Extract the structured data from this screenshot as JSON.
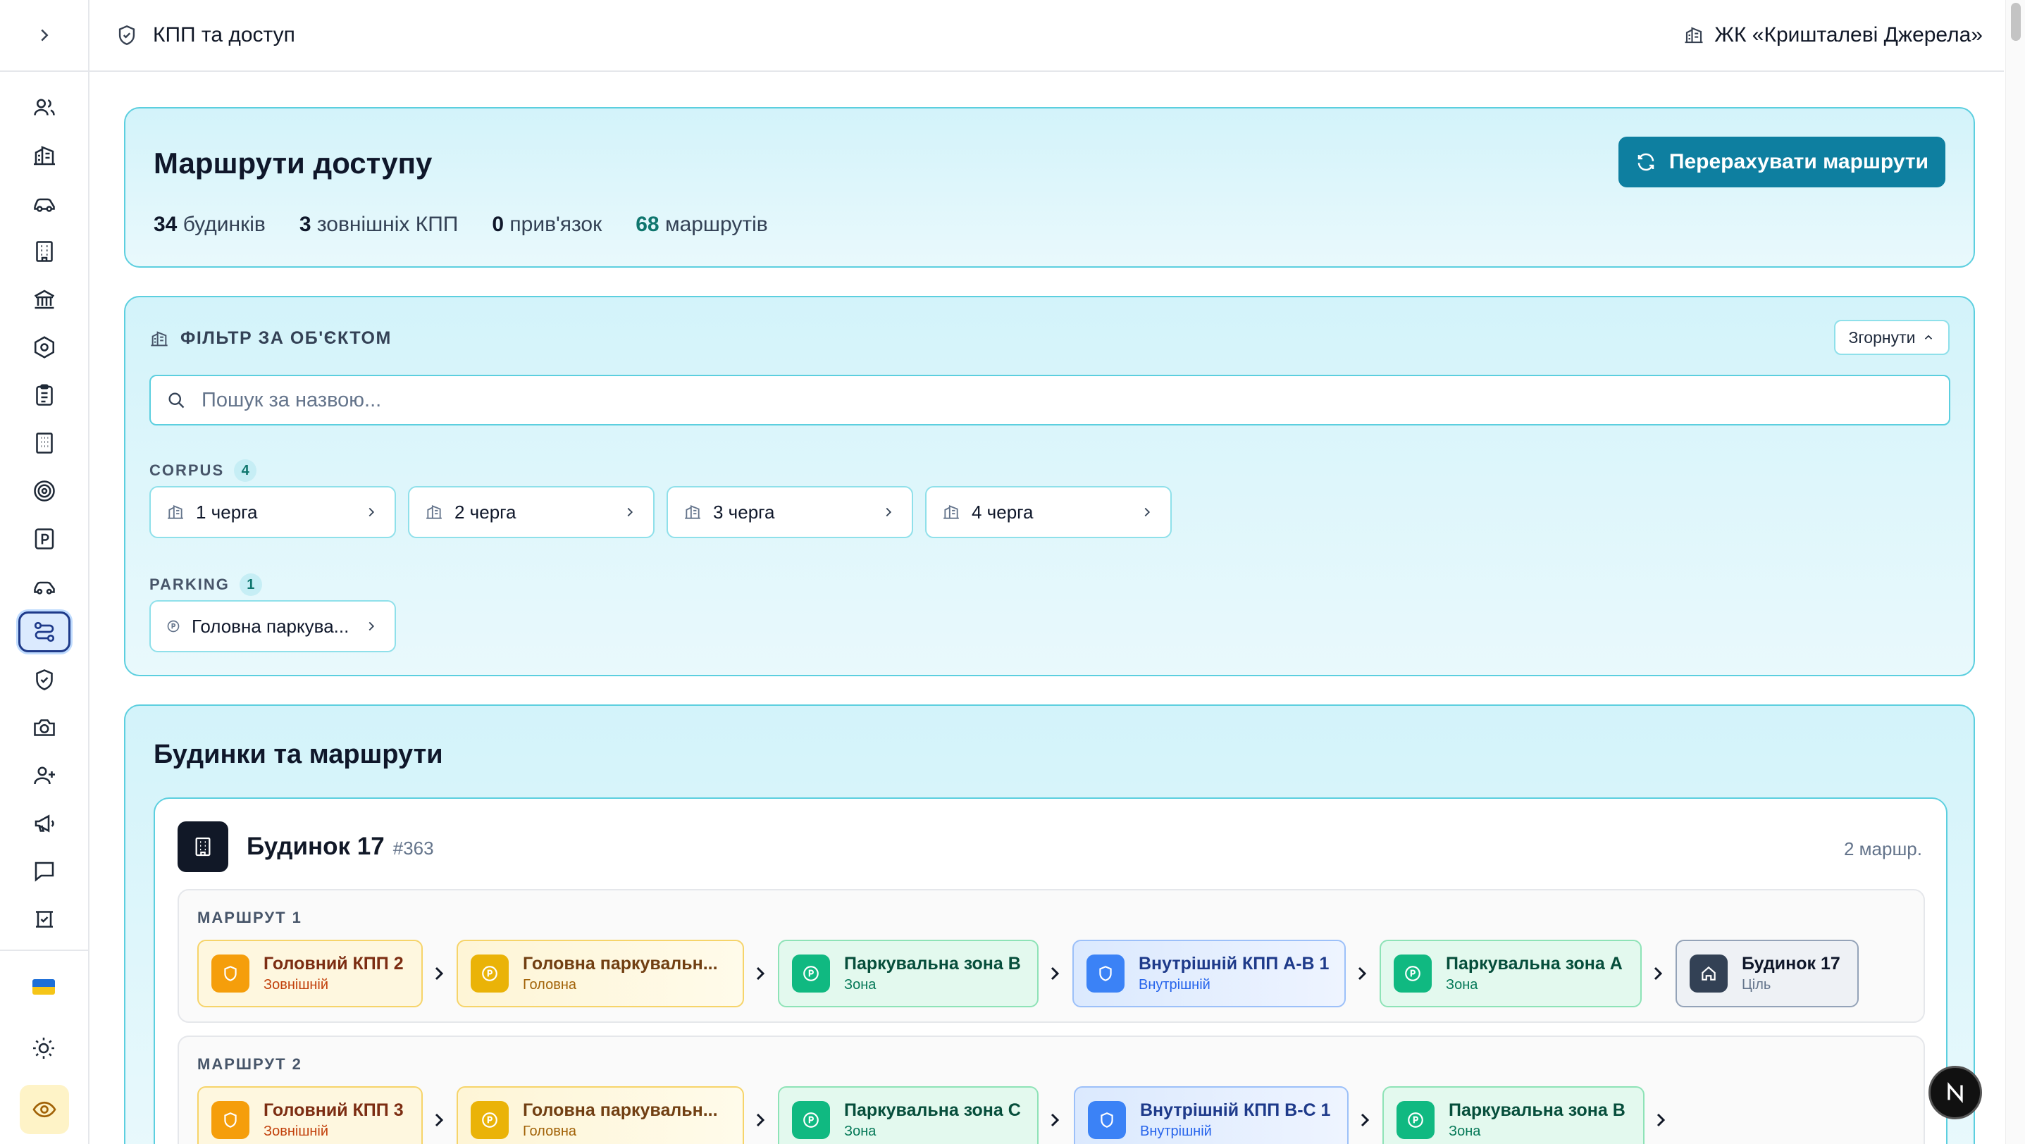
{
  "header": {
    "title": "КПП та доступ",
    "complex": "ЖК «Кришталеві Джерела»"
  },
  "summary": {
    "title": "Маршрути доступу",
    "recalc_label": "Перерахувати маршрути",
    "stats": [
      {
        "value": "34",
        "label": "будинків"
      },
      {
        "value": "3",
        "label": "зовнішніх КПП"
      },
      {
        "value": "0",
        "label": "прив'язок"
      },
      {
        "value": "68",
        "label": "маршрутів"
      }
    ]
  },
  "filter": {
    "title": "ФІЛЬТР ЗА ОБ'ЄКТОМ",
    "collapse_label": "Згорнути",
    "search_placeholder": "Пошук за назвою...",
    "groups": [
      {
        "label": "CORPUS",
        "count": "4",
        "items": [
          "1 черга",
          "2 черга",
          "3 черга",
          "4 черга"
        ]
      },
      {
        "label": "PARKING",
        "count": "1",
        "items": [
          "Головна паркува..."
        ]
      }
    ]
  },
  "buildings": {
    "title": "Будинки та маршрути",
    "card": {
      "name": "Будинок 17",
      "id": "#363",
      "route_count": "2 маршр.",
      "routes": [
        {
          "label": "МАРШРУТ 1",
          "nodes": [
            {
              "name": "Головний КПП 2",
              "type": "Зовнішній"
            },
            {
              "name": "Головна паркувальн...",
              "type": "Головна"
            },
            {
              "name": "Паркувальна зона B",
              "type": "Зона"
            },
            {
              "name": "Внутрішній КПП A-B 1",
              "type": "Внутрішній"
            },
            {
              "name": "Паркувальна зона A",
              "type": "Зона"
            },
            {
              "name": "Будинок 17",
              "type": "Ціль"
            }
          ]
        },
        {
          "label": "МАРШРУТ 2",
          "nodes": [
            {
              "name": "Головний КПП 3",
              "type": "Зовнішній"
            },
            {
              "name": "Головна паркувальн...",
              "type": "Головна"
            },
            {
              "name": "Паркувальна зона C",
              "type": "Зона"
            },
            {
              "name": "Внутрішній КПП B-C 1",
              "type": "Внутрішній"
            },
            {
              "name": "Паркувальна зона B",
              "type": "Зона"
            }
          ]
        }
      ]
    }
  },
  "colors": {
    "accent": "#0e7fa0",
    "panel_border": "#5ccfdf",
    "external": "#f59e0b",
    "zone": "#10b981",
    "internal": "#3b82f6",
    "goal": "#334155"
  },
  "icons": {
    "sidebar": [
      "users-icon",
      "building-icon",
      "car-icon",
      "office-building-icon",
      "bank-icon",
      "hexagon-icon",
      "clipboard-icon",
      "grid-building-icon",
      "target-icon",
      "parking-icon",
      "car-front-icon",
      "route-icon",
      "shield-check-icon",
      "camera-icon",
      "user-plus-icon",
      "megaphone-icon",
      "message-icon",
      "checklist-icon"
    ],
    "bottom": [
      "ukraine-flag-icon",
      "sun-icon",
      "eye-icon"
    ]
  }
}
